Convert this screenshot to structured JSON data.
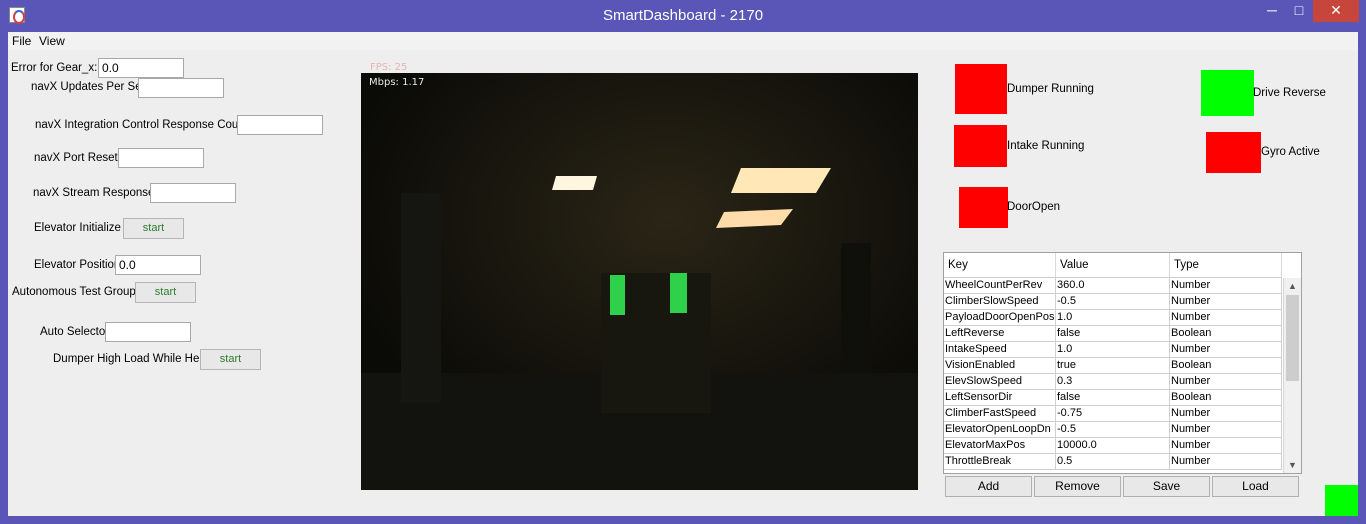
{
  "window": {
    "title": "SmartDashboard - 2170",
    "controls": {
      "minimize": "─",
      "maximize": "□",
      "close": "✕"
    }
  },
  "menu": {
    "file": "File",
    "view": "View"
  },
  "widgets": {
    "error_gear": {
      "label": "Error for Gear_x:",
      "value": "0.0"
    },
    "navx_updates": {
      "label": "navX Updates Per Sec",
      "value": ""
    },
    "navx_integration": {
      "label": "navX Integration Control Response Count",
      "value": ""
    },
    "navx_port_resets": {
      "label": "navX Port Resets",
      "value": ""
    },
    "navx_stream": {
      "label": "navX Stream Responses",
      "value": ""
    },
    "elevator_init": {
      "label": "Elevator Initialize",
      "button": "start"
    },
    "elevator_pos": {
      "label": "Elevator Position",
      "value": "0.0"
    },
    "auto_test": {
      "label": "Autonomous Test Group",
      "button": "start"
    },
    "auto_selector": {
      "label": "Auto Selector",
      "value": ""
    },
    "dumper_high": {
      "label": "Dumper High Load While Held",
      "button": "start"
    }
  },
  "camera": {
    "fps": "FPS: 25",
    "mbps": "Mbps: 1.17"
  },
  "indicators": {
    "dumper_running": {
      "label": "Dumper Running",
      "color": "#ff0000"
    },
    "drive_reverse": {
      "label": "Drive Reverse",
      "color": "#00ff00"
    },
    "intake_running": {
      "label": "Intake Running",
      "color": "#ff0000"
    },
    "gyro_active": {
      "label": "Gyro Active",
      "color": "#ff0000"
    },
    "door_open": {
      "label": "DoorOpen",
      "color": "#ff0000"
    }
  },
  "prefs_table": {
    "headers": [
      "Key",
      "Value",
      "Type"
    ],
    "rows": [
      [
        "WheelCountPerRev",
        "360.0",
        "Number"
      ],
      [
        "ClimberSlowSpeed",
        "-0.5",
        "Number"
      ],
      [
        "PayloadDoorOpenPos",
        "1.0",
        "Number"
      ],
      [
        "LeftReverse",
        "false",
        "Boolean"
      ],
      [
        "IntakeSpeed",
        "1.0",
        "Number"
      ],
      [
        "VisionEnabled",
        "true",
        "Boolean"
      ],
      [
        "ElevSlowSpeed",
        "0.3",
        "Number"
      ],
      [
        "LeftSensorDir",
        "false",
        "Boolean"
      ],
      [
        "ClimberFastSpeed",
        "-0.75",
        "Number"
      ],
      [
        "ElevatorOpenLoopDn",
        "-0.5",
        "Number"
      ],
      [
        "ElevatorMaxPos",
        "10000.0",
        "Number"
      ],
      [
        "ThrottleBreak",
        "0.5",
        "Number"
      ]
    ],
    "buttons": {
      "add": "Add",
      "remove": "Remove",
      "save": "Save",
      "load": "Load"
    }
  },
  "status_indicator": {
    "color": "#00ff00"
  }
}
